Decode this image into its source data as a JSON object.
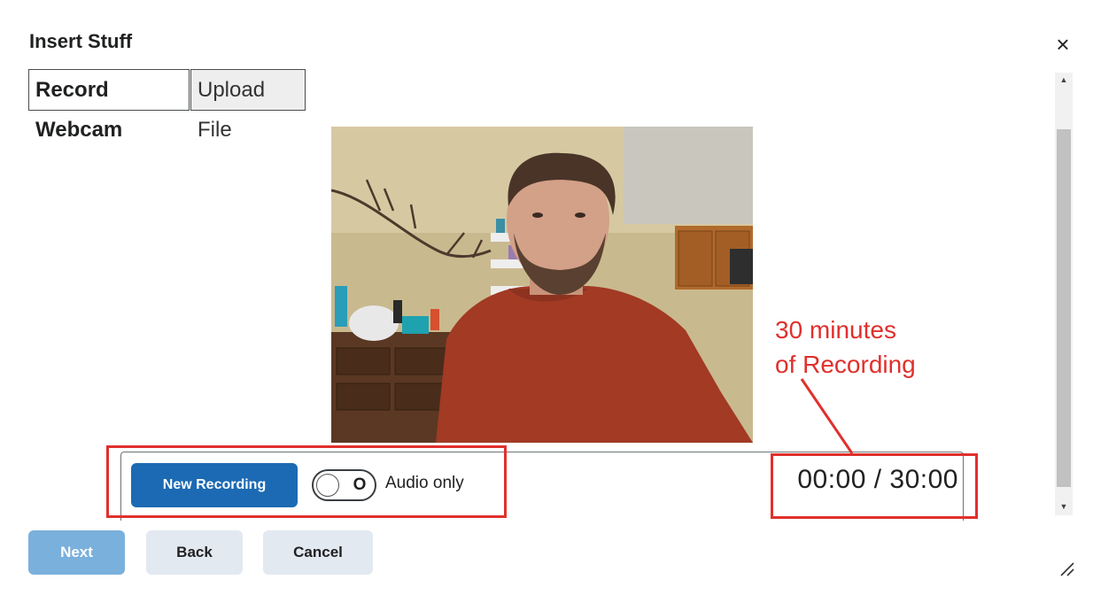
{
  "dialog": {
    "title": "Insert Stuff",
    "close_symbol": "×"
  },
  "tabs": [
    {
      "label": "Record Webcam",
      "selected": true
    },
    {
      "label": "Upload File",
      "selected": false
    }
  ],
  "recorder": {
    "new_recording_label": "New Recording",
    "audio_only_label": "Audio only",
    "audio_only_enabled": false,
    "toggle_glyph": "O",
    "timer": "00:00 / 30:00"
  },
  "annotation": {
    "line1": "30 minutes",
    "line2": "of Recording",
    "color": "#e0302c"
  },
  "footer": {
    "next_label": "Next",
    "back_label": "Back",
    "cancel_label": "Cancel"
  },
  "colors": {
    "primary": "#1c6ab3",
    "primary_disabled": "#7ab0dc",
    "secondary": "#e3e9f1"
  },
  "icons": {
    "close": "close-icon",
    "resize": "resize-grip-icon",
    "scroll_up": "scroll-up-arrow-icon",
    "scroll_down": "scroll-down-arrow-icon"
  }
}
